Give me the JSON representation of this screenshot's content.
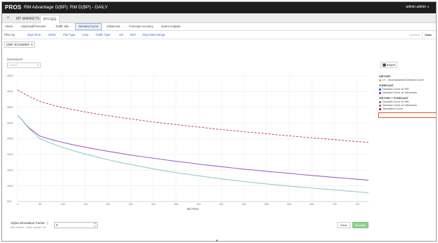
{
  "header": {
    "logo": "PROS",
    "app_title": "RM Advantage D(BP): RM D(BP) - DAILY",
    "user": "admin admin",
    "user_chevron_icon": "chevron-down-icon"
  },
  "page_tabs": {
    "home_icon": "plus-icon",
    "items": [
      {
        "label": "MY MARKETS"
      },
      {
        "label": "PIT-GIG"
      }
    ]
  },
  "sub_tabs": [
    {
      "label": "Alerts"
    },
    {
      "label": "Historical/Forecast"
    },
    {
      "label": "Traffic Mix"
    },
    {
      "label": "Demand Curve"
    },
    {
      "label": "Influences"
    },
    {
      "label": "Forecast Accuracy"
    },
    {
      "label": "Event Analysis"
    }
  ],
  "filters": {
    "label": "Filter by:",
    "items": [
      "Dept Time",
      "DOW",
      "Pax Type",
      "Cmp",
      "Traffic Type",
      "DX",
      "DCP",
      "Dept Date Range"
    ],
    "updates_label": "Updates",
    "clear_label": "Clear"
  },
  "chips": [
    {
      "prefix": "CMP:",
      "value": "ECONOMY"
    }
  ],
  "dimensions": {
    "label": "Dimensions",
    "placeholder": "Select..."
  },
  "export_label": "Export",
  "chart_data": {
    "type": "line",
    "xlabel": "Bid Price",
    "ylabel": "",
    "x": [
      0,
      25,
      50,
      75,
      100,
      125,
      150,
      175,
      200,
      225,
      250,
      275,
      300,
      325,
      350,
      375,
      400,
      425,
      450,
      475,
      500,
      525,
      550,
      575,
      600,
      625,
      650,
      675,
      700,
      725,
      750,
      775
    ],
    "x_ticks": [
      0,
      50,
      100,
      150,
      200,
      250,
      300,
      350,
      400,
      450,
      500,
      550,
      600,
      650,
      700,
      750
    ],
    "y_ticks": [
      "50K",
      "100K",
      "150K",
      "200K",
      "250K",
      "300K",
      "350K",
      "400K",
      "450K"
    ],
    "ylim": [
      50000,
      450000
    ],
    "grid": true,
    "series": [
      {
        "name": "Simulation Curve",
        "style": "dashed",
        "color": "#c0323c",
        "values": [
          405000,
          385000,
          368000,
          358000,
          349000,
          342000,
          335000,
          329000,
          323000,
          318000,
          313000,
          308000,
          303000,
          299000,
          295000,
          291000,
          287000,
          283000,
          279000,
          276000,
          272000,
          269000,
          266000,
          262000,
          259000,
          256000,
          253000,
          250000,
          247000,
          244000,
          241000,
          238000
        ]
      },
      {
        "name": "Demand Curve w/ Influences",
        "style": "solid",
        "color": "#a060c8",
        "values": [
          325000,
          285000,
          258000,
          247000,
          238000,
          230000,
          223000,
          216000,
          210000,
          204000,
          198000,
          193000,
          188000,
          183000,
          178000,
          174000,
          169000,
          165000,
          161000,
          157000,
          153000,
          150000,
          146000,
          143000,
          140000,
          136000,
          133000,
          130000,
          127000,
          124000,
          121000,
          118000
        ]
      },
      {
        "name": "Demand Curve w/ HIE",
        "style": "solid",
        "color": "#8ecfc8",
        "values": [
          325000,
          283000,
          250000,
          235000,
          222000,
          211000,
          201000,
          192000,
          183000,
          175000,
          168000,
          161000,
          154000,
          148000,
          142000,
          137000,
          132000,
          127000,
          122000,
          118000,
          114000,
          110000,
          106000,
          103000,
          99000,
          96000,
          93000,
          90000,
          87000,
          84000,
          81000,
          78000
        ]
      }
    ]
  },
  "legend": {
    "groups": [
      {
        "title": "HISTORY",
        "items": [
          {
            "label": "LY - Unconstrained Demand Curve",
            "color": "#e3b23c"
          }
        ]
      },
      {
        "title": "FORECAST",
        "items": [
          {
            "label": "Demand Curve w/ HIE",
            "color": "#3d6fd4"
          },
          {
            "label": "Demand Curve w/ Influences",
            "color": "#7a4bd0"
          }
        ]
      },
      {
        "title": "HISTORY + FORECAST",
        "items": [
          {
            "label": "Demand Curve w/ HIE",
            "color": "#5aa04a"
          },
          {
            "label": "Demand Curve w/ Influences",
            "color": "#9a6fc8"
          },
          {
            "label": "Simulation Curve",
            "color": "#c0323c"
          }
        ]
      }
    ]
  },
  "alpha": {
    "label": "Alpha Simulation Factor",
    "hint": "Min number: 1  Max number: 10",
    "value": "5",
    "info_icon": "info-icon"
  },
  "actions": {
    "clear_label": "Clear",
    "simulate_label": "Simulate"
  },
  "bottom_handle_icon": "chevron-up-icon",
  "bottom_handle_glyph": "▲"
}
